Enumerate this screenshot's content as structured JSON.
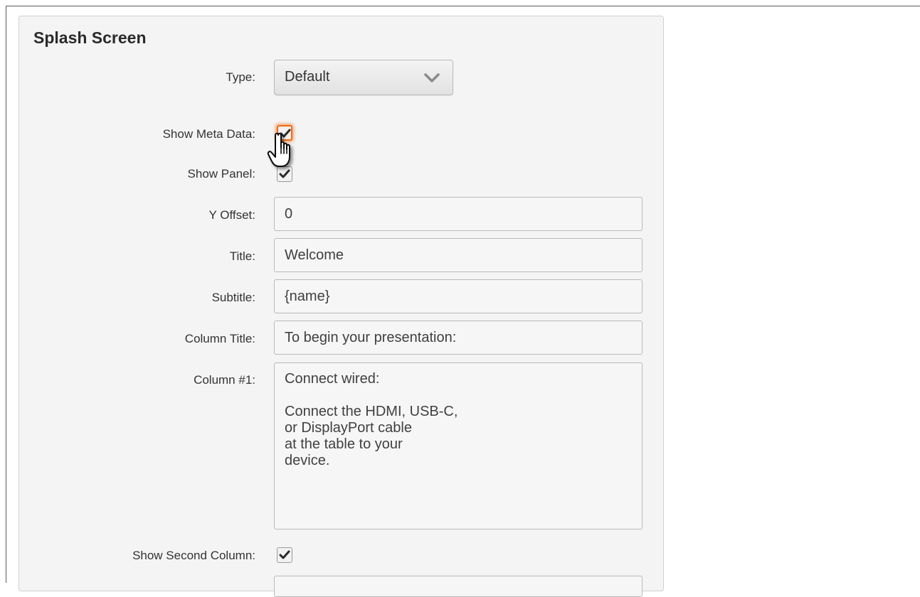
{
  "section": {
    "title": "Splash Screen"
  },
  "fields": {
    "type": {
      "label": "Type:",
      "value": "Default"
    },
    "show_meta_data": {
      "label": "Show Meta Data:",
      "checked": true
    },
    "show_panel": {
      "label": "Show Panel:",
      "checked": true
    },
    "y_offset": {
      "label": "Y Offset:",
      "value": "0"
    },
    "title": {
      "label": "Title:",
      "value": "Welcome"
    },
    "subtitle": {
      "label": "Subtitle:",
      "value": "{name}"
    },
    "column_title": {
      "label": "Column Title:",
      "value": "To begin your presentation:"
    },
    "column_1": {
      "label": "Column #1:",
      "value": "Connect wired:\n\nConnect the HDMI, USB-C,\nor DisplayPort cable\nat the table to your\ndevice."
    },
    "show_second_column": {
      "label": "Show Second Column:",
      "checked": true
    }
  },
  "colors": {
    "focus_ring": "#f26a12",
    "panel_bg": "#f4f4f4"
  },
  "icons": {
    "select": "chevron-down-icon",
    "check": "checkmark-icon",
    "pointer": "hand-pointer-icon"
  }
}
